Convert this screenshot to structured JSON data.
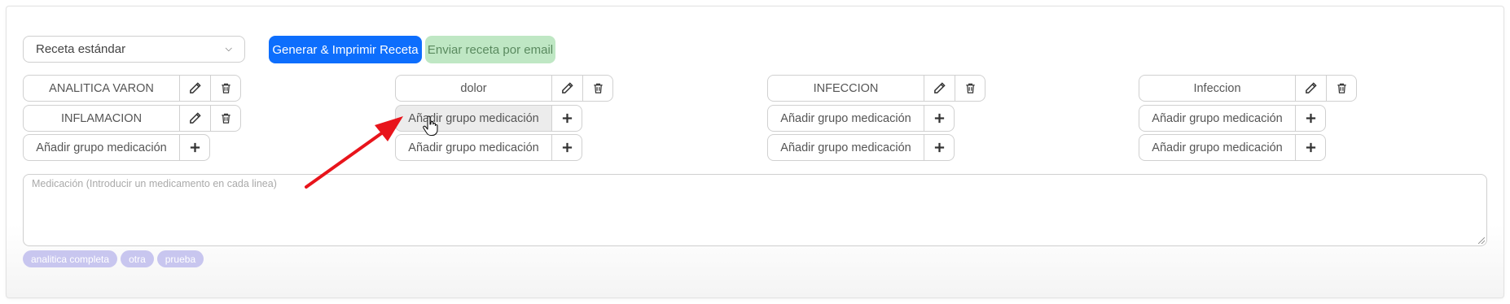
{
  "recipe_type": {
    "selected": "Receta estándar"
  },
  "actions": {
    "generate_label": "Generar & Imprimir Receta",
    "email_label": "Enviar receta por email"
  },
  "groups": {
    "col1": [
      "ANALITICA VARON",
      "INFLAMACION"
    ],
    "col2": [
      "dolor"
    ],
    "col3": [
      "INFECCION"
    ],
    "col4": [
      "Infeccion"
    ]
  },
  "add_group_label": "Añadir grupo medicación",
  "medication": {
    "placeholder": "Medicación (Introducir un medicamento en cada linea)"
  },
  "tags": [
    "analitica completa",
    "otra",
    "prueba"
  ],
  "colors": {
    "primary": "#0d6efd",
    "email_button": "#bfe7c4",
    "tag": "#c8c6ef",
    "annotation_arrow": "#e8141b"
  },
  "icons": {
    "edit": "pencil-icon",
    "delete": "trash-icon",
    "add": "plus-icon"
  }
}
